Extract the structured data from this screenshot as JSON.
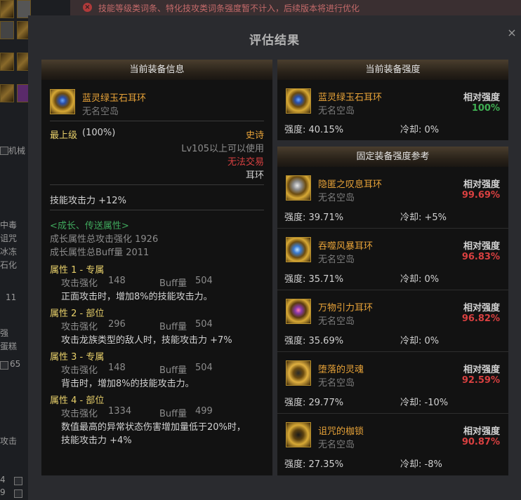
{
  "background": {
    "notice": "技能等级类词条、特化技攻类词条强度暂不计入，后续版本将进行优化",
    "left_texts": [
      "机械",
      "中毒",
      "诅咒",
      "冰冻",
      "石化",
      "11",
      "强",
      "蛋糕",
      "65",
      "攻击",
      "4",
      "9"
    ]
  },
  "modal": {
    "title": "评估结果",
    "close_label": "×"
  },
  "current_info": {
    "header": "当前装备信息",
    "item_name": "蓝灵绿玉石耳环",
    "item_sub": "无名空岛",
    "grade": "最上级",
    "grade_pct": "(100%)",
    "rarity": "史诗",
    "level_req": "Lv105以上可以使用",
    "trade": "无法交易",
    "slot": "耳环",
    "base_stat": "技能攻击力  +12%",
    "growth_title": "<成长、传送属性>",
    "growth_atk": "成长属性总攻击强化 1926",
    "growth_buff": "成长属性总Buff量 2011",
    "attributes": [
      {
        "title": "属性 1 - 专属",
        "atk_label": "攻击强化",
        "atk": "148",
        "buff_label": "Buff量",
        "buff": "504",
        "desc": "正面攻击时，增加8%的技能攻击力。"
      },
      {
        "title": "属性 2 - 部位",
        "atk_label": "攻击强化",
        "atk": "296",
        "buff_label": "Buff量",
        "buff": "504",
        "desc": "攻击龙族类型的敌人时，技能攻击力 +7%"
      },
      {
        "title": "属性 3 - 专属",
        "atk_label": "攻击强化",
        "atk": "148",
        "buff_label": "Buff量",
        "buff": "504",
        "desc": "背击时，增加8%的技能攻击力。"
      },
      {
        "title": "属性 4 - 部位",
        "atk_label": "攻击强化",
        "atk": "1334",
        "buff_label": "Buff量",
        "buff": "499",
        "desc": "数值最高的异常状态伤害增加量低于20%时，",
        "desc2": "技能攻击力 +4%"
      }
    ]
  },
  "current_strength": {
    "header": "当前装备强度",
    "item_name": "蓝灵绿玉石耳环",
    "item_sub": "无名空岛",
    "rel_label": "相对强度",
    "rel_value": "100%",
    "strength": "强度: 40.15%",
    "cooldown": "冷却: 0%"
  },
  "reference": {
    "header": "固定装备强度参考",
    "items": [
      {
        "name": "隐匿之叹息耳环",
        "sub": "无名空岛",
        "rel_label": "相对强度",
        "rel_value": "99.69%",
        "strength": "强度: 39.71%",
        "cooldown": "冷却: +5%",
        "icon": "sigh-earring-icon"
      },
      {
        "name": "吞噬风暴耳环",
        "sub": "无名空岛",
        "rel_label": "相对强度",
        "rel_value": "96.83%",
        "strength": "强度: 35.71%",
        "cooldown": "冷却: 0%",
        "icon": "storm-earring-icon"
      },
      {
        "name": "万物引力耳环",
        "sub": "无名空岛",
        "rel_label": "相对强度",
        "rel_value": "96.82%",
        "strength": "强度: 35.69%",
        "cooldown": "冷却: 0%",
        "icon": "gravity-earring-icon"
      },
      {
        "name": "堕落的灵魂",
        "sub": "无名空岛",
        "rel_label": "相对强度",
        "rel_value": "92.59%",
        "strength": "强度: 29.77%",
        "cooldown": "冷却: -10%",
        "icon": "fallen-soul-icon"
      },
      {
        "name": "诅咒的枷锁",
        "sub": "无名空岛",
        "rel_label": "相对强度",
        "rel_value": "90.87%",
        "strength": "强度: 27.35%",
        "cooldown": "冷却: -8%",
        "icon": "cursed-shackle-icon"
      }
    ]
  },
  "colors": {
    "item_name": "#e8a338",
    "relative_top": "#3fae52",
    "relative_other": "#d84040",
    "header_bg": "#4a3e2e"
  }
}
